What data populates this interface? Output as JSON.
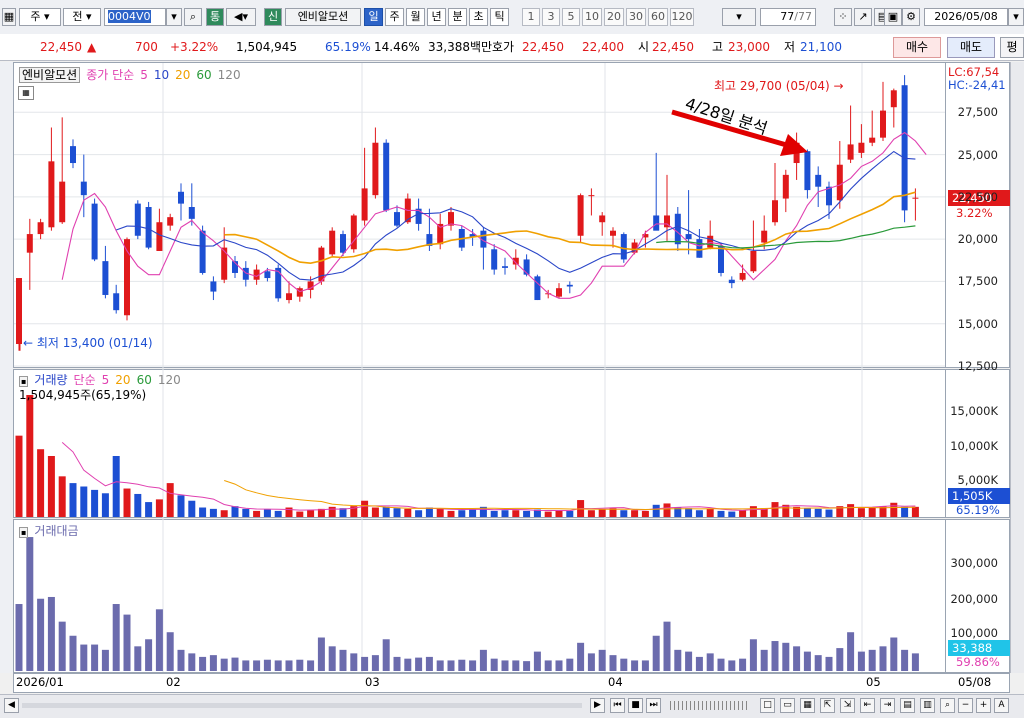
{
  "toolbar": {
    "market_type": "주",
    "market_type2": "전",
    "stock_code": "0004V0",
    "tong_label": "통",
    "sin_label": "신",
    "stock_name": "엔비알모션",
    "periods": [
      "일",
      "주",
      "월",
      "년",
      "분",
      "초",
      "틱"
    ],
    "selected_period": "일",
    "numbers": [
      "1",
      "3",
      "5",
      "10",
      "20",
      "30",
      "60",
      "120"
    ],
    "count": "77",
    "count_total": "/77",
    "date": "2026/05/08"
  },
  "quote": {
    "price": "22,450",
    "arrow": "▲",
    "change": "700",
    "change_pct": "+3.22%",
    "volume": "1,504,945",
    "vol_ratio": "65.19%",
    "turnover": "14.46%",
    "amount": "33,388백만",
    "hoga_label": "호가",
    "ask": "22,450",
    "bid": "22,400",
    "open_label": "시",
    "open": "22,450",
    "high_label": "고",
    "high": "23,000",
    "low_label": "저",
    "low": "21,100",
    "buy_label": "매수",
    "sell_label": "매도",
    "eval_label": "평"
  },
  "price_panel": {
    "legend_name": "엔비알모션",
    "legend_ma": "종가 단순",
    "ma_periods": [
      "5",
      "10",
      "20",
      "60",
      "120"
    ],
    "lc": "LC:67,54",
    "hc": "HC:-24,41",
    "y_ticks": [
      "27,500",
      "25,000",
      "22,500",
      "20,000",
      "17,500",
      "15,000",
      "12,500"
    ],
    "last_price": "22,450",
    "last_pct": "3.22%",
    "max_label": "최고 29,700 (05/04)",
    "min_label": "최저 13,400 (01/14)",
    "annotation": "4/28일 분석"
  },
  "volume_panel": {
    "legend_name": "거래량",
    "legend_ma": "단순",
    "ma_periods": [
      "5",
      "20",
      "60",
      "120"
    ],
    "info": "1,504,945주(65,19%)",
    "y_ticks": [
      "15,000K",
      "10,000K",
      "5,000K"
    ],
    "last_value": "1,505K",
    "last_pct": "65.19%"
  },
  "amount_panel": {
    "legend_name": "거래대금",
    "y_ticks": [
      "300,000",
      "200,000",
      "100,000"
    ],
    "last_value": "33,388",
    "last_pct": "59.86%"
  },
  "x_axis": {
    "labels": [
      "2026/01",
      "02",
      "03",
      "04",
      "05"
    ],
    "right_label": "05/08"
  },
  "colors": {
    "up": "#e0191b",
    "down": "#1c4fd3",
    "ma5": "#e040b0",
    "ma10": "#2a46c8",
    "ma20": "#f0a000",
    "ma60": "#2a9a3a",
    "amount_bar": "#6b6bad"
  },
  "chart_data": {
    "type": "candlestick",
    "ylim": [
      12500,
      30000
    ],
    "candles": [
      {
        "o": 13800,
        "h": 13800,
        "l": 13400,
        "c": 17700
      },
      {
        "o": 19200,
        "h": 21200,
        "l": 17000,
        "c": 20300
      },
      {
        "o": 20300,
        "h": 21200,
        "l": 20000,
        "c": 21000
      },
      {
        "o": 20700,
        "h": 26600,
        "l": 20500,
        "c": 24600
      },
      {
        "o": 21000,
        "h": 27200,
        "l": 20900,
        "c": 23400
      },
      {
        "o": 25500,
        "h": 25900,
        "l": 24200,
        "c": 24500
      },
      {
        "o": 23400,
        "h": 25000,
        "l": 21300,
        "c": 22600
      },
      {
        "o": 22100,
        "h": 22400,
        "l": 18700,
        "c": 18800
      },
      {
        "o": 18700,
        "h": 19600,
        "l": 16500,
        "c": 16700
      },
      {
        "o": 16800,
        "h": 17300,
        "l": 15600,
        "c": 15800
      },
      {
        "o": 15500,
        "h": 20100,
        "l": 15200,
        "c": 20000
      },
      {
        "o": 22100,
        "h": 22300,
        "l": 20000,
        "c": 20200
      },
      {
        "o": 21900,
        "h": 22200,
        "l": 19400,
        "c": 19500
      },
      {
        "o": 19300,
        "h": 21800,
        "l": 19300,
        "c": 21000
      },
      {
        "o": 20800,
        "h": 21500,
        "l": 20500,
        "c": 21300
      },
      {
        "o": 22800,
        "h": 23300,
        "l": 21100,
        "c": 22100
      },
      {
        "o": 21900,
        "h": 23300,
        "l": 20800,
        "c": 21200
      },
      {
        "o": 20500,
        "h": 20800,
        "l": 17900,
        "c": 18000
      },
      {
        "o": 17500,
        "h": 17800,
        "l": 16400,
        "c": 16900
      },
      {
        "o": 17600,
        "h": 20700,
        "l": 17400,
        "c": 19500
      },
      {
        "o": 18700,
        "h": 19000,
        "l": 17700,
        "c": 18000
      },
      {
        "o": 18300,
        "h": 18700,
        "l": 17200,
        "c": 17600
      },
      {
        "o": 17600,
        "h": 18500,
        "l": 17300,
        "c": 18200
      },
      {
        "o": 18100,
        "h": 18300,
        "l": 17500,
        "c": 17700
      },
      {
        "o": 18300,
        "h": 18500,
        "l": 16300,
        "c": 16500
      },
      {
        "o": 16400,
        "h": 17500,
        "l": 16200,
        "c": 16800
      },
      {
        "o": 16600,
        "h": 17200,
        "l": 16300,
        "c": 17100
      },
      {
        "o": 17000,
        "h": 17800,
        "l": 16500,
        "c": 17500
      },
      {
        "o": 17500,
        "h": 19600,
        "l": 17300,
        "c": 19500
      },
      {
        "o": 19100,
        "h": 20700,
        "l": 19000,
        "c": 20500
      },
      {
        "o": 20300,
        "h": 20500,
        "l": 19000,
        "c": 19200
      },
      {
        "o": 19400,
        "h": 21500,
        "l": 19200,
        "c": 21400
      },
      {
        "o": 21100,
        "h": 25400,
        "l": 20800,
        "c": 23000
      },
      {
        "o": 22600,
        "h": 26600,
        "l": 22400,
        "c": 25700
      },
      {
        "o": 25700,
        "h": 25900,
        "l": 21600,
        "c": 21700
      },
      {
        "o": 21600,
        "h": 22000,
        "l": 20700,
        "c": 20800
      },
      {
        "o": 21000,
        "h": 22700,
        "l": 20900,
        "c": 22400
      },
      {
        "o": 21800,
        "h": 22400,
        "l": 20500,
        "c": 20900
      },
      {
        "o": 20300,
        "h": 21800,
        "l": 19300,
        "c": 19600
      },
      {
        "o": 19700,
        "h": 21500,
        "l": 19400,
        "c": 20900
      },
      {
        "o": 20800,
        "h": 21900,
        "l": 20500,
        "c": 21600
      },
      {
        "o": 20600,
        "h": 20800,
        "l": 19300,
        "c": 19500
      },
      {
        "o": 20300,
        "h": 20600,
        "l": 19600,
        "c": 20100
      },
      {
        "o": 20500,
        "h": 20700,
        "l": 18200,
        "c": 19500
      },
      {
        "o": 19400,
        "h": 19700,
        "l": 17900,
        "c": 18200
      },
      {
        "o": 18400,
        "h": 18900,
        "l": 17900,
        "c": 18300
      },
      {
        "o": 18500,
        "h": 19400,
        "l": 18200,
        "c": 18900
      },
      {
        "o": 18800,
        "h": 19100,
        "l": 17800,
        "c": 17900
      },
      {
        "o": 17800,
        "h": 17900,
        "l": 16400,
        "c": 16400
      },
      {
        "o": 16800,
        "h": 17000,
        "l": 16500,
        "c": 16800
      },
      {
        "o": 16600,
        "h": 17400,
        "l": 16500,
        "c": 17100
      },
      {
        "o": 17300,
        "h": 17500,
        "l": 16800,
        "c": 17200
      },
      {
        "o": 20200,
        "h": 22700,
        "l": 19800,
        "c": 22600
      },
      {
        "o": 22600,
        "h": 23000,
        "l": 21400,
        "c": 22600
      },
      {
        "o": 21000,
        "h": 21600,
        "l": 20200,
        "c": 21400
      },
      {
        "o": 20200,
        "h": 20700,
        "l": 19500,
        "c": 20500
      },
      {
        "o": 20300,
        "h": 20400,
        "l": 18600,
        "c": 18800
      },
      {
        "o": 19200,
        "h": 20000,
        "l": 19100,
        "c": 19800
      },
      {
        "o": 20100,
        "h": 20500,
        "l": 19500,
        "c": 20300
      },
      {
        "o": 21400,
        "h": 25100,
        "l": 20900,
        "c": 20500
      },
      {
        "o": 20700,
        "h": 23800,
        "l": 19900,
        "c": 21400
      },
      {
        "o": 21500,
        "h": 21900,
        "l": 19300,
        "c": 19700
      },
      {
        "o": 20300,
        "h": 22900,
        "l": 19100,
        "c": 20000
      },
      {
        "o": 20000,
        "h": 20600,
        "l": 18900,
        "c": 18900
      },
      {
        "o": 19500,
        "h": 21100,
        "l": 19400,
        "c": 20200
      },
      {
        "o": 19600,
        "h": 19800,
        "l": 17800,
        "c": 18000
      },
      {
        "o": 17600,
        "h": 17800,
        "l": 17100,
        "c": 17400
      },
      {
        "o": 17600,
        "h": 18500,
        "l": 17500,
        "c": 18000
      },
      {
        "o": 18100,
        "h": 21100,
        "l": 18000,
        "c": 19300
      },
      {
        "o": 19800,
        "h": 21400,
        "l": 19400,
        "c": 20500
      },
      {
        "o": 21000,
        "h": 24500,
        "l": 20800,
        "c": 22300
      },
      {
        "o": 22400,
        "h": 24100,
        "l": 21600,
        "c": 23800
      },
      {
        "o": 24500,
        "h": 26300,
        "l": 23500,
        "c": 25700
      },
      {
        "o": 25200,
        "h": 25300,
        "l": 22400,
        "c": 22900
      },
      {
        "o": 23800,
        "h": 24300,
        "l": 21900,
        "c": 23100
      },
      {
        "o": 23100,
        "h": 23400,
        "l": 21200,
        "c": 22000
      },
      {
        "o": 22300,
        "h": 25800,
        "l": 21800,
        "c": 24400
      },
      {
        "o": 24700,
        "h": 27900,
        "l": 24500,
        "c": 25600
      },
      {
        "o": 25100,
        "h": 26800,
        "l": 24800,
        "c": 25700
      },
      {
        "o": 25700,
        "h": 27600,
        "l": 25500,
        "c": 26000
      },
      {
        "o": 26000,
        "h": 29300,
        "l": 25800,
        "c": 27600
      },
      {
        "o": 27800,
        "h": 28900,
        "l": 26600,
        "c": 28800
      },
      {
        "o": 29100,
        "h": 29700,
        "l": 21000,
        "c": 21700
      },
      {
        "o": 22450,
        "h": 23000,
        "l": 21100,
        "c": 22450
      }
    ],
    "ma5": [
      null,
      null,
      null,
      null,
      17600,
      20600,
      22300,
      22700,
      21900,
      20500,
      19300,
      18400,
      17900,
      17900,
      19300,
      20700,
      21100,
      20400,
      19900,
      19300,
      18600,
      18000,
      17800,
      18200,
      18100,
      17400,
      16900,
      17100,
      17500,
      18300,
      19100,
      19900,
      20700,
      21500,
      21700,
      21900,
      21700,
      21700,
      21300,
      20700,
      20900,
      20800,
      20400,
      19900,
      19600,
      19300,
      18600,
      18000,
      17400,
      16800,
      16500,
      16500,
      16700,
      17400,
      18400,
      18400,
      18400,
      19200,
      20400,
      20900,
      20900,
      20400,
      19800,
      19600,
      19800,
      19700,
      19000,
      18300,
      17600,
      18200,
      18800,
      19900,
      20800,
      22000,
      22800,
      23000,
      23200,
      23600,
      24300,
      24600,
      25100,
      25900,
      26300,
      25800,
      25000
    ]
  }
}
